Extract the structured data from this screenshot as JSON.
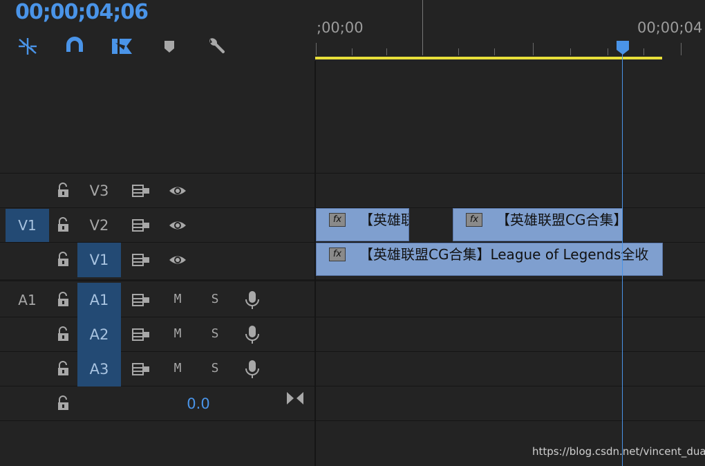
{
  "header": {
    "timecode": "00;00;04;06"
  },
  "toolbar": {
    "tools": [
      {
        "name": "nest-icon",
        "active": true
      },
      {
        "name": "snap-magnet-icon",
        "active": true
      },
      {
        "name": "linked-selection-icon",
        "active": true
      },
      {
        "name": "add-marker-icon",
        "active": false
      },
      {
        "name": "wrench-settings-icon",
        "active": false
      }
    ]
  },
  "ruler": {
    "start_label": ";00;00",
    "end_label": "00;00;04"
  },
  "video_tracks": [
    {
      "source": "",
      "target": "V3",
      "target_active": false
    },
    {
      "source": "V1",
      "target": "V2",
      "target_active": false
    },
    {
      "source": "",
      "target": "V1",
      "target_active": true
    }
  ],
  "audio_tracks": [
    {
      "source": "A1",
      "target": "A1",
      "mute": "M",
      "solo": "S"
    },
    {
      "source": "",
      "target": "A2",
      "mute": "M",
      "solo": "S"
    },
    {
      "source": "",
      "target": "A3",
      "mute": "M",
      "solo": "S"
    }
  ],
  "master": {
    "volume": "0.0"
  },
  "clips": {
    "v2_a": {
      "fx": "fx",
      "label": "【英雄联"
    },
    "v2_b": {
      "fx": "fx",
      "label": "【英雄联盟CG合集】"
    },
    "v1_a": {
      "fx": "fx",
      "label": "【英雄联盟CG合集】League of Legends全收"
    }
  },
  "watermark": "https://blog.csdn.net/vincent_duan",
  "colors": {
    "accent": "#4a94e8",
    "clip": "#7f9fcf",
    "work_area": "#e8df3a",
    "target_on": "#234a74"
  }
}
